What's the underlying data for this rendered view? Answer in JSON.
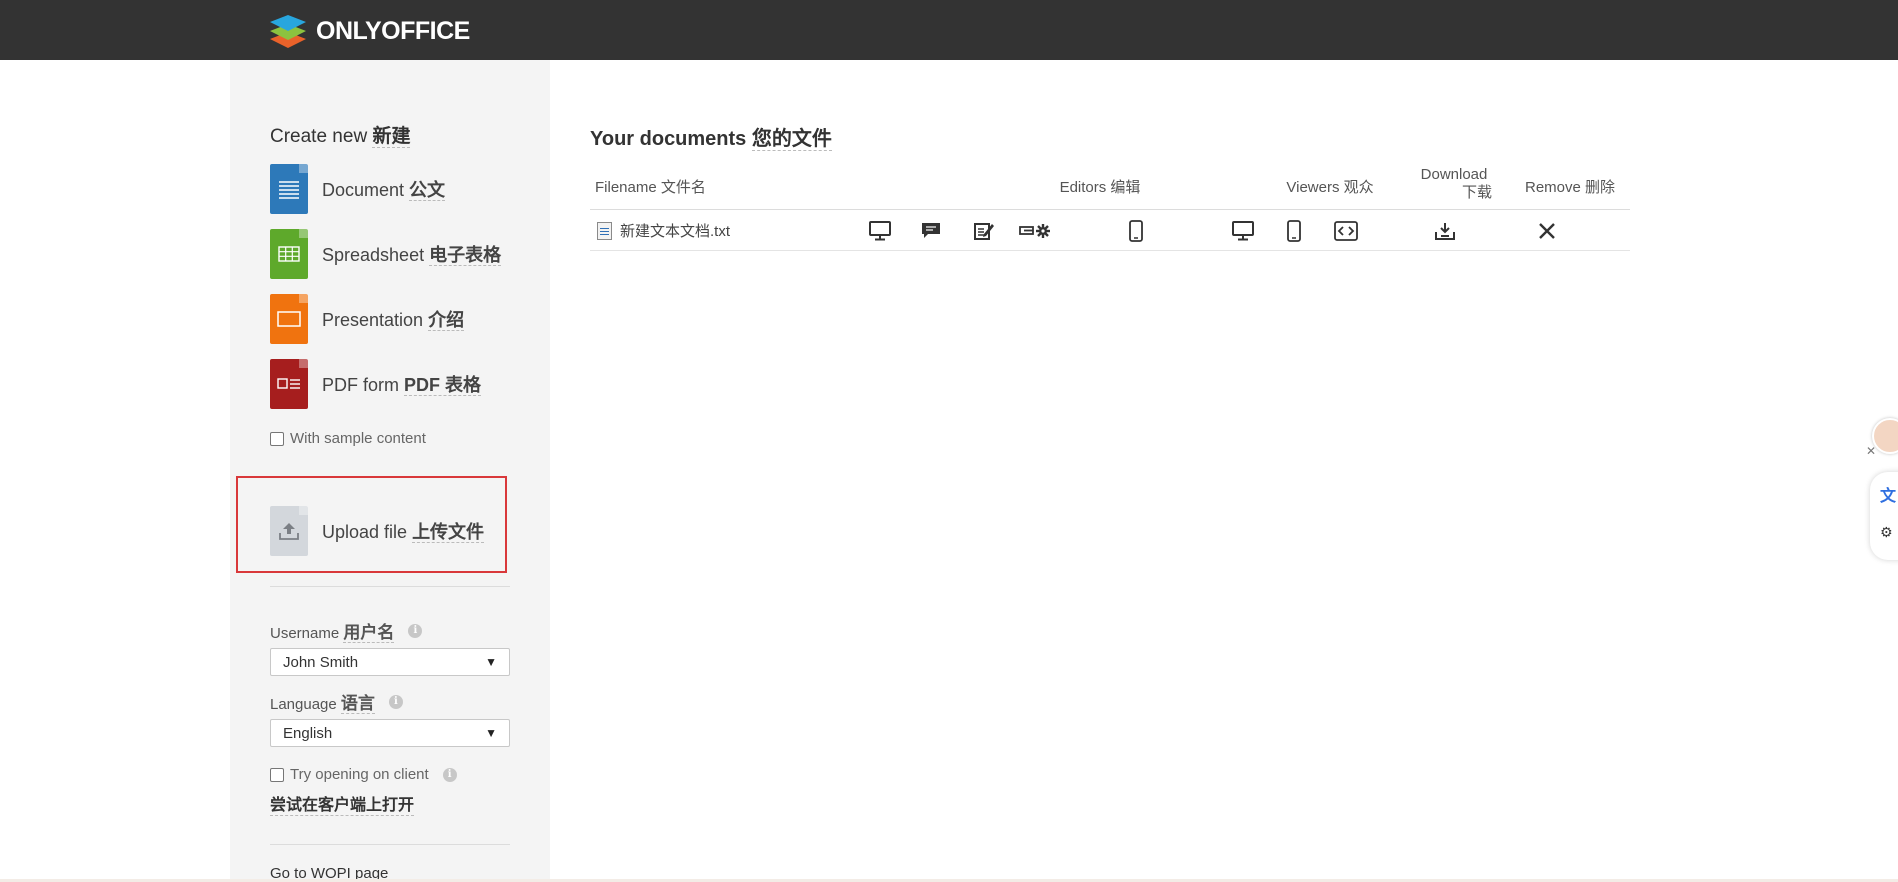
{
  "brand": {
    "name": "ONLYOFFICE"
  },
  "sidebar": {
    "create_title_en": "Create new ",
    "create_title_cn": "新建",
    "items": [
      {
        "en": "Document ",
        "cn": "公文",
        "icon": "document-icon",
        "color": "#2d79b9"
      },
      {
        "en": "Spreadsheet ",
        "cn": "电子表格",
        "icon": "spreadsheet-icon",
        "color": "#5ea92b"
      },
      {
        "en": "Presentation ",
        "cn": "介绍",
        "icon": "presentation-icon",
        "color": "#f0730f"
      },
      {
        "en": "PDF form ",
        "cn": "PDF 表格",
        "icon": "pdf-form-icon",
        "color": "#a61e1e"
      }
    ],
    "sample_label": "With sample content",
    "upload": {
      "en": "Upload file ",
      "cn": "上传文件"
    },
    "username": {
      "label_en": "Username ",
      "label_cn": "用户名",
      "value": "John Smith"
    },
    "language": {
      "label_en": "Language ",
      "label_cn": "语言",
      "value": "English"
    },
    "try_client": {
      "label": "Try opening on client",
      "cn": "尝试在客户端上打开"
    },
    "wopi_link": "Go to WOPI page"
  },
  "main": {
    "title_en": "Your documents ",
    "title_cn": "您的文件",
    "headers": {
      "filename": "Filename 文件名",
      "editors": "Editors 编辑",
      "viewers": "Viewers 观众",
      "download_1": "Download",
      "download_2": "下载",
      "remove": "Remove 删除"
    },
    "files": [
      {
        "name": "新建文本文档.txt"
      }
    ]
  },
  "widget": {
    "btn1": "文",
    "btn2": "⚙"
  },
  "colors": {
    "topbar": "#333333",
    "sidebar": "#f4f4f4",
    "highlight": "#d9383a"
  }
}
